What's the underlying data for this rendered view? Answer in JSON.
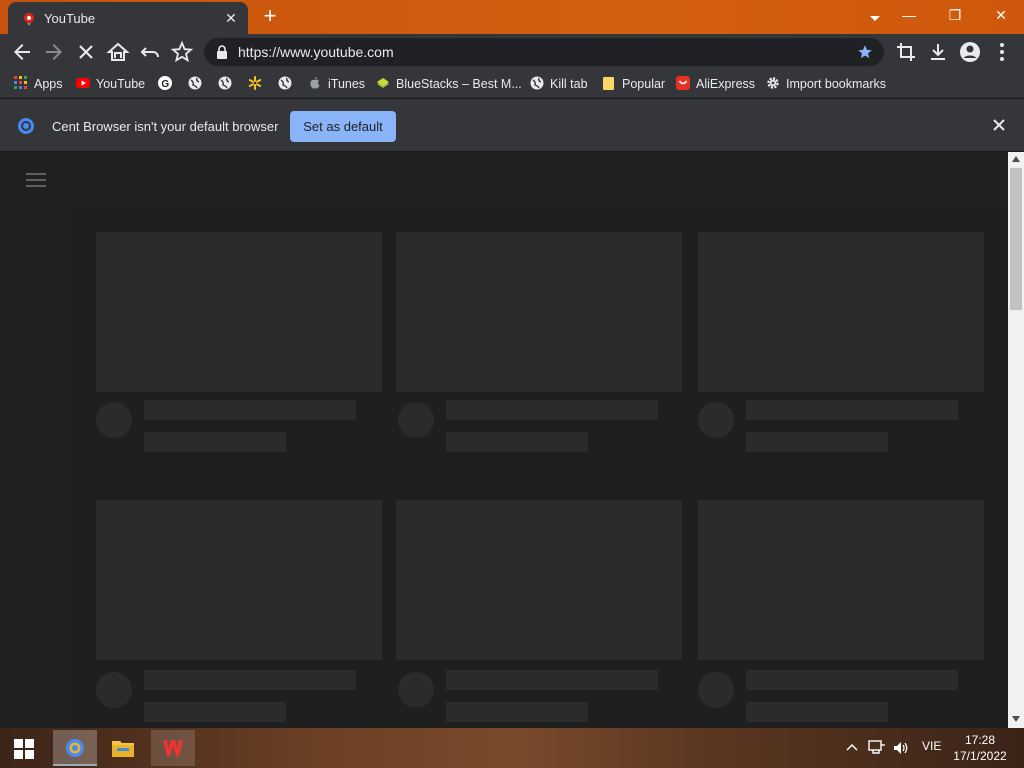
{
  "tab": {
    "title": "YouTube",
    "close": "✕"
  },
  "window": {
    "new_tab": "+",
    "minimize": "—",
    "restore": "❐",
    "close": "✕"
  },
  "toolbar": {
    "url": "https://www.youtube.com"
  },
  "bookmarks": [
    {
      "label": "Apps",
      "icon": "apps-grid-icon"
    },
    {
      "label": "YouTube",
      "icon": "youtube-icon"
    },
    {
      "label": "",
      "icon": "google-icon"
    },
    {
      "label": "",
      "icon": "globe-icon"
    },
    {
      "label": "",
      "icon": "globe-icon"
    },
    {
      "label": "",
      "icon": "walmart-icon"
    },
    {
      "label": "",
      "icon": "globe-icon"
    },
    {
      "label": "iTunes",
      "icon": "apple-icon"
    },
    {
      "label": "BlueStacks – Best M...",
      "icon": "bluestacks-icon"
    },
    {
      "label": "Kill tab",
      "icon": "globe-icon"
    },
    {
      "label": "Popular",
      "icon": "folder-icon"
    },
    {
      "label": "AliExpress",
      "icon": "aliexpress-icon"
    },
    {
      "label": "Import bookmarks",
      "icon": "gear-icon"
    }
  ],
  "infobar": {
    "message": "Cent Browser isn't your default browser",
    "button": "Set as default"
  },
  "taskbar": {
    "language": "VIE",
    "time": "17:28",
    "date": "17/1/2022"
  },
  "colors": {
    "tabstrip": "#d2600f",
    "accent_button": "#8ab4f8",
    "page_bg": "#232323",
    "placeholder": "#2b2b2b"
  }
}
